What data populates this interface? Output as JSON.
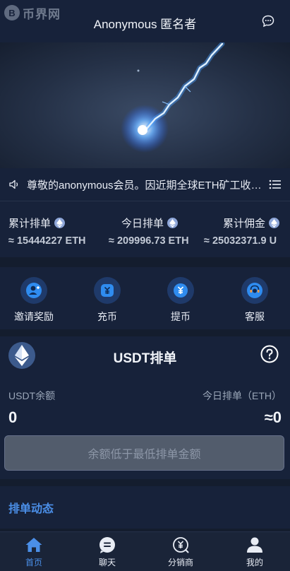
{
  "header": {
    "logo_text": "币界网",
    "title": "Anonymous 匿名者",
    "chat_icon": "chat-bubble-icon"
  },
  "notice": {
    "text": "尊敬的anonymous会员。因近期全球ETH矿工收益下降",
    "icon": "speaker-icon",
    "list_icon": "list-icon"
  },
  "stats": [
    {
      "label": "累计排单",
      "value": "≈ 15444227 ETH"
    },
    {
      "label": "今日排单",
      "value": "≈ 209996.73 ETH"
    },
    {
      "label": "累计佣金",
      "value": "≈ 25032371.9 U"
    }
  ],
  "actions": [
    {
      "label": "邀请奖励",
      "icon": "user-plus-icon"
    },
    {
      "label": "充币",
      "icon": "deposit-icon"
    },
    {
      "label": "提币",
      "icon": "withdraw-icon"
    },
    {
      "label": "客服",
      "icon": "customer-service-icon"
    }
  ],
  "usdt": {
    "title": "USDT排单",
    "balance_label": "USDT余额",
    "balance_value": "0",
    "today_label": "今日排单（ETH）",
    "today_value": "≈0",
    "submit_label": "余额低于最低排单金额"
  },
  "records": {
    "title": "排单动态"
  },
  "tabbar": [
    {
      "label": "首页",
      "icon": "home-icon",
      "active": true
    },
    {
      "label": "聊天",
      "icon": "chat-icon",
      "active": false
    },
    {
      "label": "分销商",
      "icon": "distributor-icon",
      "active": false
    },
    {
      "label": "我的",
      "icon": "profile-icon",
      "active": false
    }
  ],
  "colors": {
    "background": "#141d2e",
    "card": "#17223a",
    "accent": "#4b8fe8",
    "disabled_button": "#525c6c"
  }
}
